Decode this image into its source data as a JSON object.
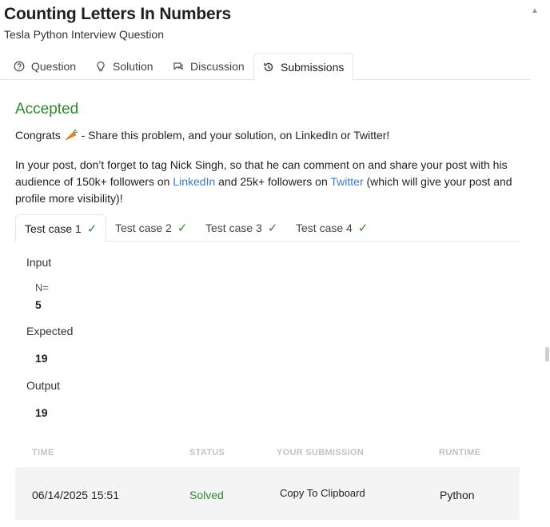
{
  "header": {
    "title": "Counting Letters In Numbers",
    "subtitle": "Tesla Python Interview Question"
  },
  "tabs": [
    {
      "label": "Question",
      "icon": "question-circle-icon"
    },
    {
      "label": "Solution",
      "icon": "lightbulb-icon"
    },
    {
      "label": "Discussion",
      "icon": "chat-icon"
    },
    {
      "label": "Submissions",
      "icon": "history-icon",
      "active": true
    }
  ],
  "result": {
    "status": "Accepted",
    "congrats_prefix": "Congrats",
    "congrats_text": " - Share this problem, and your solution, on LinkedIn or Twitter!",
    "share_part1": "In your post, don’t forget to tag Nick Singh, so that he can comment on and share your post with his audience of 150k+ followers on ",
    "linkedin": "LinkedIn",
    "share_part2": " and 25k+ followers on ",
    "twitter": "Twitter",
    "share_part3": " (which will give your post and profile more visibility)!"
  },
  "test_cases": [
    {
      "label": "Test case 1",
      "active": true
    },
    {
      "label": "Test case 2"
    },
    {
      "label": "Test case 3"
    },
    {
      "label": "Test case 4"
    }
  ],
  "case_detail": {
    "input_label": "Input",
    "var_name": "N=",
    "var_value": "5",
    "expected_label": "Expected",
    "expected_value": "19",
    "output_label": "Output",
    "output_value": "19"
  },
  "submissions": {
    "headers": [
      "TIME",
      "STATUS",
      "YOUR SUBMISSION",
      "RUNTIME"
    ],
    "rows": [
      {
        "time": "06/14/2025 15:51",
        "status": "Solved",
        "submission": "Copy To Clipboard",
        "runtime": "Python"
      }
    ]
  },
  "colors": {
    "accent_green": "#2c8a2c",
    "link_blue": "#3a7bc8"
  }
}
